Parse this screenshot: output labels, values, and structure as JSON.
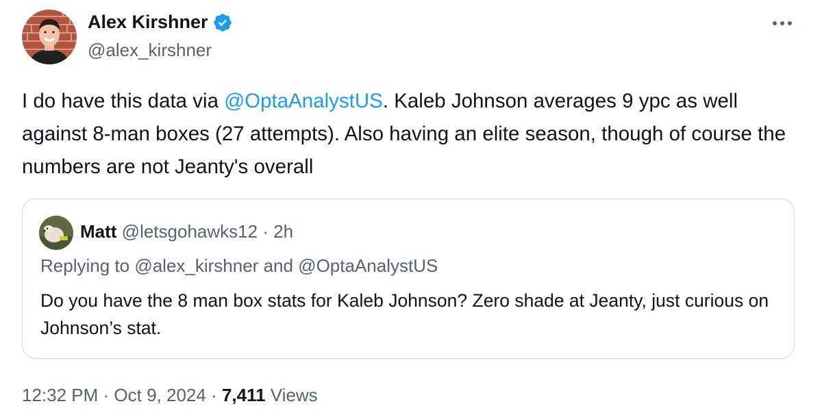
{
  "author": {
    "name": "Alex Kirshner",
    "handle": "@alex_kirshner",
    "verified": true,
    "avatar": "person-photo-avatar"
  },
  "tweet": {
    "text_before": "I do have this data via ",
    "mention": "@OptaAnalystUS",
    "text_after": ". Kaleb Johnson averages 9 ypc as well against 8-man boxes (27 attempts). Also having an elite season, though of course the numbers are not Jeanty's overall"
  },
  "quote": {
    "name": "Matt",
    "handle": "@letsgohawks12",
    "separator": " · ",
    "time": "2h",
    "avatar": "dog-photo-avatar",
    "replying_prefix": "Replying to ",
    "replying_user1": "@alex_kirshner",
    "replying_and": " and ",
    "replying_user2": "@OptaAnalystUS",
    "text": "Do you have the 8 man box stats for Kaleb Johnson? Zero shade at Jeanty, just curious on Johnson’s stat."
  },
  "meta": {
    "time": "12:32 PM",
    "dot1": " · ",
    "date": "Oct 9, 2024",
    "dot2": " · ",
    "views_count": "7,411",
    "views_label": " Views"
  },
  "colors": {
    "accent": "#1d9bf0",
    "text": "#0f1419",
    "secondary": "#536471",
    "border": "#cfd9de"
  },
  "icons": {
    "more": "more-horizontal-icon",
    "verified": "verified-badge-icon"
  }
}
